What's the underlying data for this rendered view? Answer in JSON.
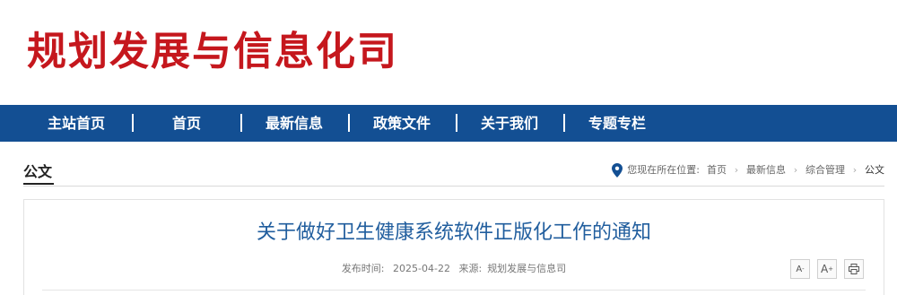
{
  "header": {
    "site_title": "规划发展与信息化司"
  },
  "nav": {
    "items": [
      "主站首页",
      "首页",
      "最新信息",
      "政策文件",
      "关于我们",
      "专题专栏"
    ],
    "separator": "|"
  },
  "breadcrumb": {
    "section": "公文",
    "prefix": "您现在所在位置:",
    "links": [
      "首页",
      "最新信息",
      "综合管理"
    ],
    "current": "公文",
    "separator": "›"
  },
  "article": {
    "title": "关于做好卫生健康系统软件正版化工作的通知",
    "publish_label": "发布时间:",
    "publish_date": "2025-04-22",
    "source_label": "来源:",
    "source": "规划发展与信息司",
    "tools": {
      "font_small": "A",
      "font_large": "A",
      "print_icon": "print-icon"
    }
  },
  "colors": {
    "brand_red": "#c5171d",
    "nav_blue": "#134f93",
    "title_blue": "#215e9e"
  }
}
